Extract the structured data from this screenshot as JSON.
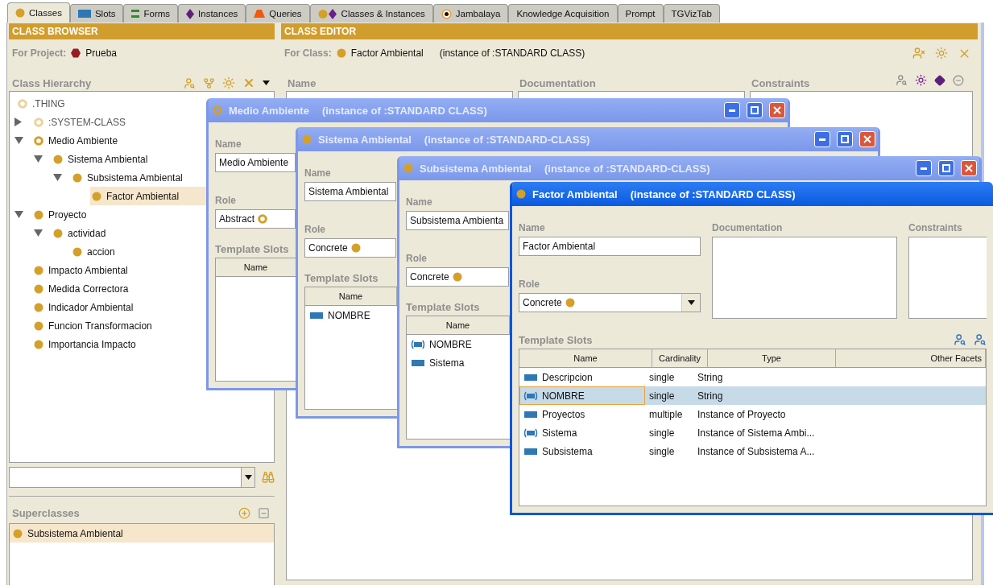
{
  "tabs": [
    {
      "label": "Classes",
      "kind": "class",
      "selected": true
    },
    {
      "label": "Slots",
      "kind": "slot",
      "selected": false
    },
    {
      "label": "Forms",
      "kind": "form",
      "selected": false
    },
    {
      "label": "Instances",
      "kind": "instance",
      "selected": false
    },
    {
      "label": "Queries",
      "kind": "query",
      "selected": false
    },
    {
      "label": "Classes & Instances",
      "kind": "mixed",
      "selected": false
    },
    {
      "label": "Jambalaya",
      "kind": "target",
      "selected": false
    },
    {
      "label": "Knowledge Acquisition",
      "kind": "plain",
      "selected": false
    },
    {
      "label": "Prompt",
      "kind": "plain",
      "selected": false
    },
    {
      "label": "TGVizTab",
      "kind": "plain",
      "selected": false
    }
  ],
  "class_browser": {
    "title": "CLASS BROWSER",
    "project_label": "For Project:",
    "project": "Prueba",
    "hierarchy_label": "Class Hierarchy",
    "tree": {
      "label": ".THING",
      "kind": "abstract",
      "system": true,
      "selected": false,
      "children": [
        {
          "label": ":SYSTEM-CLASS",
          "kind": "abstract",
          "system": true,
          "selected": false,
          "expanded": false
        },
        {
          "label": "Medio Ambiente",
          "kind": "abstract",
          "system": false,
          "selected": false,
          "expanded": true,
          "children": [
            {
              "label": "Sistema Ambiental",
              "kind": "concrete",
              "system": false,
              "selected": false,
              "expanded": true,
              "children": [
                {
                  "label": "Subsistema Ambiental",
                  "kind": "concrete",
                  "system": false,
                  "selected": false,
                  "expanded": true,
                  "children": [
                    {
                      "label": "Factor Ambiental",
                      "kind": "concrete",
                      "system": false,
                      "selected": true
                    }
                  ]
                }
              ]
            }
          ]
        },
        {
          "label": "Proyecto",
          "kind": "concrete",
          "system": false,
          "selected": false,
          "expanded": true,
          "children": [
            {
              "label": "actividad",
              "kind": "concrete",
              "system": false,
              "selected": false,
              "expanded": true,
              "children": [
                {
                  "label": "accion",
                  "kind": "concrete",
                  "system": false,
                  "selected": false
                }
              ]
            }
          ]
        },
        {
          "label": "Impacto Ambiental",
          "kind": "concrete",
          "system": false,
          "selected": false
        },
        {
          "label": "Medida Correctora",
          "kind": "concrete",
          "system": false,
          "selected": false
        },
        {
          "label": "Indicador Ambiental",
          "kind": "concrete",
          "system": false,
          "selected": false
        },
        {
          "label": "Funcion Transformacion",
          "kind": "concrete",
          "system": false,
          "selected": false
        },
        {
          "label": "Importancia Impacto",
          "kind": "concrete",
          "system": false,
          "selected": false
        }
      ]
    },
    "superclasses_label": "Superclasses",
    "superclasses": [
      {
        "label": "Subsistema Ambiental",
        "kind": "concrete",
        "selected": true
      }
    ]
  },
  "class_editor": {
    "title": "CLASS EDITOR",
    "class_label": "For Class:",
    "class": {
      "name": "Factor Ambiental",
      "kind": "concrete"
    },
    "class_type": "(instance of :STANDARD CLASS)",
    "labels": [
      "Name",
      "Documentation",
      "Constraints"
    ]
  },
  "windows": [
    {
      "title": "Medio Ambiente",
      "class_type": "(instance of :STANDARD CLASS)",
      "kind": "abstract",
      "active": false,
      "name_label": "Name",
      "name": "Medio Ambiente",
      "role_label": "Role",
      "role": "Abstract",
      "slots_label": "Template Slots",
      "slot_columns": [
        "Name"
      ]
    },
    {
      "title": "Sistema Ambiental",
      "class_type": "(instance of :STANDARD-CLASS)",
      "kind": "concrete",
      "active": false,
      "name_label": "Name",
      "name": "Sistema Ambiental",
      "role_label": "Role",
      "role": "Concrete",
      "slots_label": "Template Slots",
      "slot_columns": [
        "Name"
      ],
      "slots": [
        {
          "name": "NOMBRE",
          "inherited": false,
          "selected": false
        }
      ]
    },
    {
      "title": "Subsistema Ambiental",
      "class_type": "(instance of :STANDARD-CLASS)",
      "kind": "concrete",
      "active": false,
      "name_label": "Name",
      "name": "Subsistema Ambienta",
      "role_label": "Role",
      "role": "Concrete",
      "slots_label": "Template Slots",
      "slot_columns": [
        "Name"
      ],
      "slots": [
        {
          "name": "NOMBRE",
          "inherited": true,
          "selected": false
        },
        {
          "name": "Sistema",
          "inherited": false,
          "selected": false
        }
      ]
    },
    {
      "title": "Factor Ambiental",
      "class_type": "(instance of :STANDARD CLASS)",
      "kind": "concrete",
      "active": true,
      "name_label": "Name",
      "name": "Factor Ambiental",
      "role_label": "Role",
      "role": "Concrete",
      "documentation_label": "Documentation",
      "constraints_label": "Constraints",
      "slots_label": "Template Slots",
      "slot_columns": [
        "Name",
        "Cardinality",
        "Type",
        "Other Facets"
      ],
      "slots": [
        {
          "name": "Descripcion",
          "cardinality": "single",
          "type": "String",
          "inherited": false,
          "selected": false
        },
        {
          "name": "NOMBRE",
          "cardinality": "single",
          "type": "String",
          "inherited": true,
          "selected": true
        },
        {
          "name": "Proyectos",
          "cardinality": "multiple",
          "type": "Instance of Proyecto",
          "inherited": false,
          "selected": false
        },
        {
          "name": "Sistema",
          "cardinality": "single",
          "type": "Instance of Sistema Ambi...",
          "inherited": true,
          "selected": false
        },
        {
          "name": "Subsistema",
          "cardinality": "single",
          "type": "Instance of Subsistema A...",
          "inherited": false,
          "selected": false
        }
      ]
    }
  ]
}
